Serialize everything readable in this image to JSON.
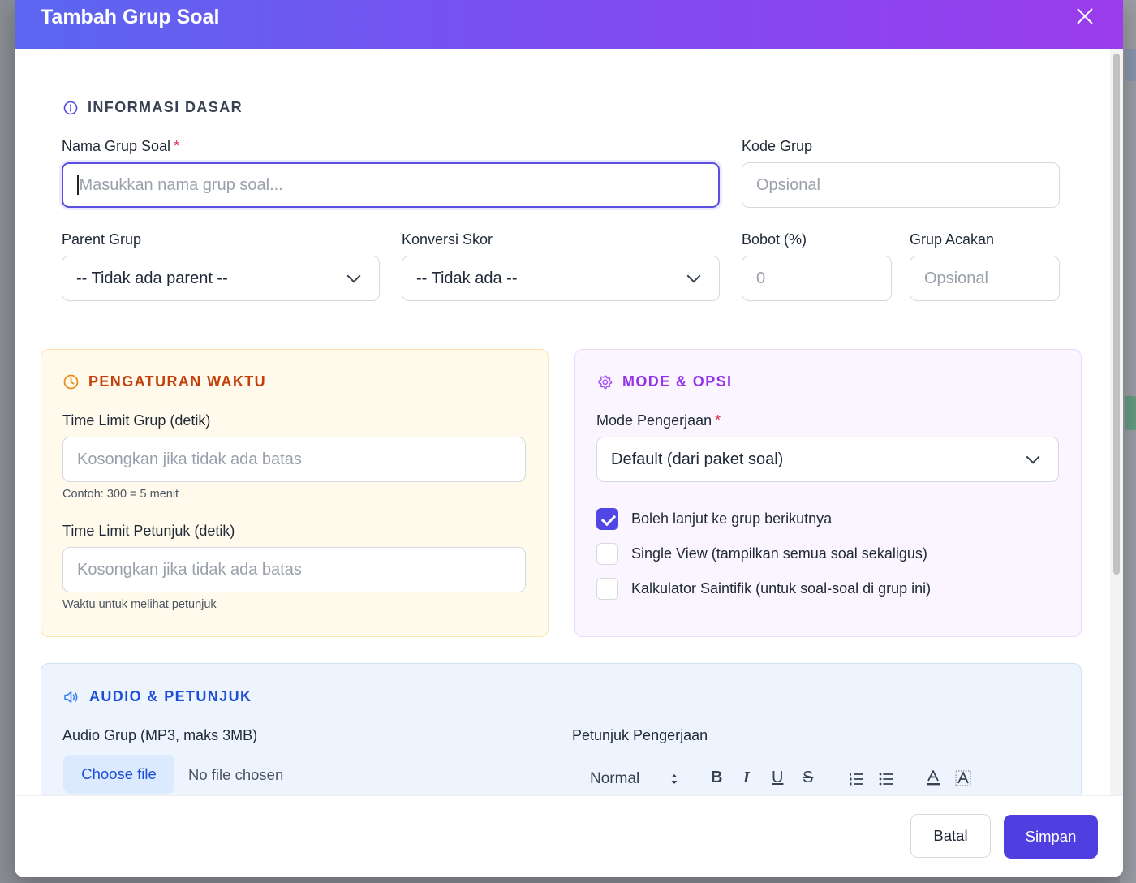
{
  "modal": {
    "title": "Tambah Grup Soal"
  },
  "informasi_dasar": {
    "heading": "INFORMASI DASAR",
    "nama_label": "Nama Grup Soal",
    "nama_required": "*",
    "nama_placeholder": "Masukkan nama grup soal...",
    "kode_label": "Kode Grup",
    "kode_placeholder": "Opsional",
    "parent_label": "Parent Grup",
    "parent_value": "-- Tidak ada parent --",
    "konversi_label": "Konversi Skor",
    "konversi_value": "-- Tidak ada --",
    "bobot_label": "Bobot (%)",
    "bobot_placeholder": "0",
    "acakan_label": "Grup Acakan",
    "acakan_placeholder": "Opsional"
  },
  "pengaturan_waktu": {
    "heading": "PENGATURAN WAKTU",
    "grup_label": "Time Limit Grup (detik)",
    "grup_placeholder": "Kosongkan jika tidak ada batas",
    "grup_hint": "Contoh: 300 = 5 menit",
    "petunjuk_label": "Time Limit Petunjuk (detik)",
    "petunjuk_placeholder": "Kosongkan jika tidak ada batas",
    "petunjuk_hint": "Waktu untuk melihat petunjuk"
  },
  "mode_opsi": {
    "heading": "MODE & OPSI",
    "mode_label": "Mode Pengerjaan",
    "mode_required": "*",
    "mode_value": "Default (dari paket soal)",
    "options": [
      {
        "label": "Boleh lanjut ke grup berikutnya",
        "checked": true
      },
      {
        "label": "Single View (tampilkan semua soal sekaligus)",
        "checked": false
      },
      {
        "label": "Kalkulator Saintifik (untuk soal-soal di grup ini)",
        "checked": false
      }
    ]
  },
  "audio_petunjuk": {
    "heading": "AUDIO & PETUNJUK",
    "audio_label": "Audio Grup (MP3, maks 3MB)",
    "choose_file": "Choose file",
    "no_file": "No file chosen",
    "petunjuk_label": "Petunjuk Pengerjaan",
    "toolbar": {
      "format": "Normal",
      "bold": "B",
      "italic": "I",
      "underline": "U",
      "strike": "S"
    }
  },
  "footer": {
    "cancel": "Batal",
    "save": "Simpan"
  },
  "colors": {
    "accent": "#4f46e5",
    "waktu": "#c2410c",
    "mode": "#9333ea",
    "audio": "#1d4ed8"
  }
}
